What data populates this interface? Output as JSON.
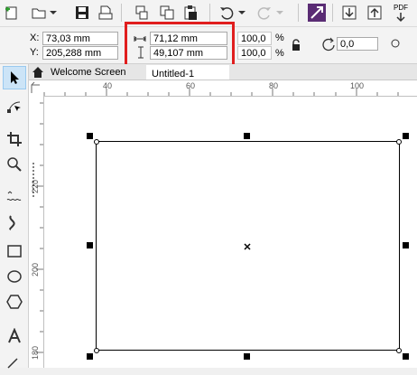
{
  "toolbar": {
    "icons": [
      "new-document-icon",
      "open-folder-icon",
      "dropdown-icon",
      "save-icon",
      "print-icon",
      "cut-icon",
      "copy-icon",
      "paste-icon",
      "undo-icon",
      "undo-dropdown-icon",
      "redo-icon",
      "redo-dropdown-icon",
      "launch-icon",
      "import-icon",
      "export-icon",
      "publish-pdf-icon"
    ],
    "pdf_label": "PDF"
  },
  "propbar": {
    "x_label": "X:",
    "x_value": "73,03 mm",
    "y_label": "Y:",
    "y_value": "205,288 mm",
    "width_value": "71,12 mm",
    "height_value": "49,107 mm",
    "scale_w": "100,0",
    "scale_h": "100,0",
    "percent_1": "%",
    "percent_2": "%",
    "rotation_value": "0,0"
  },
  "tabs": [
    {
      "label": "Welcome Screen"
    },
    {
      "label": "Untitled-1"
    }
  ],
  "ruler_h": [
    "40",
    "60",
    "80",
    "100"
  ],
  "ruler_v": [
    "220",
    "200",
    "180"
  ],
  "colors": {
    "highlight": "#e01e1e",
    "toolbar_bg": "#f3f3f3"
  }
}
